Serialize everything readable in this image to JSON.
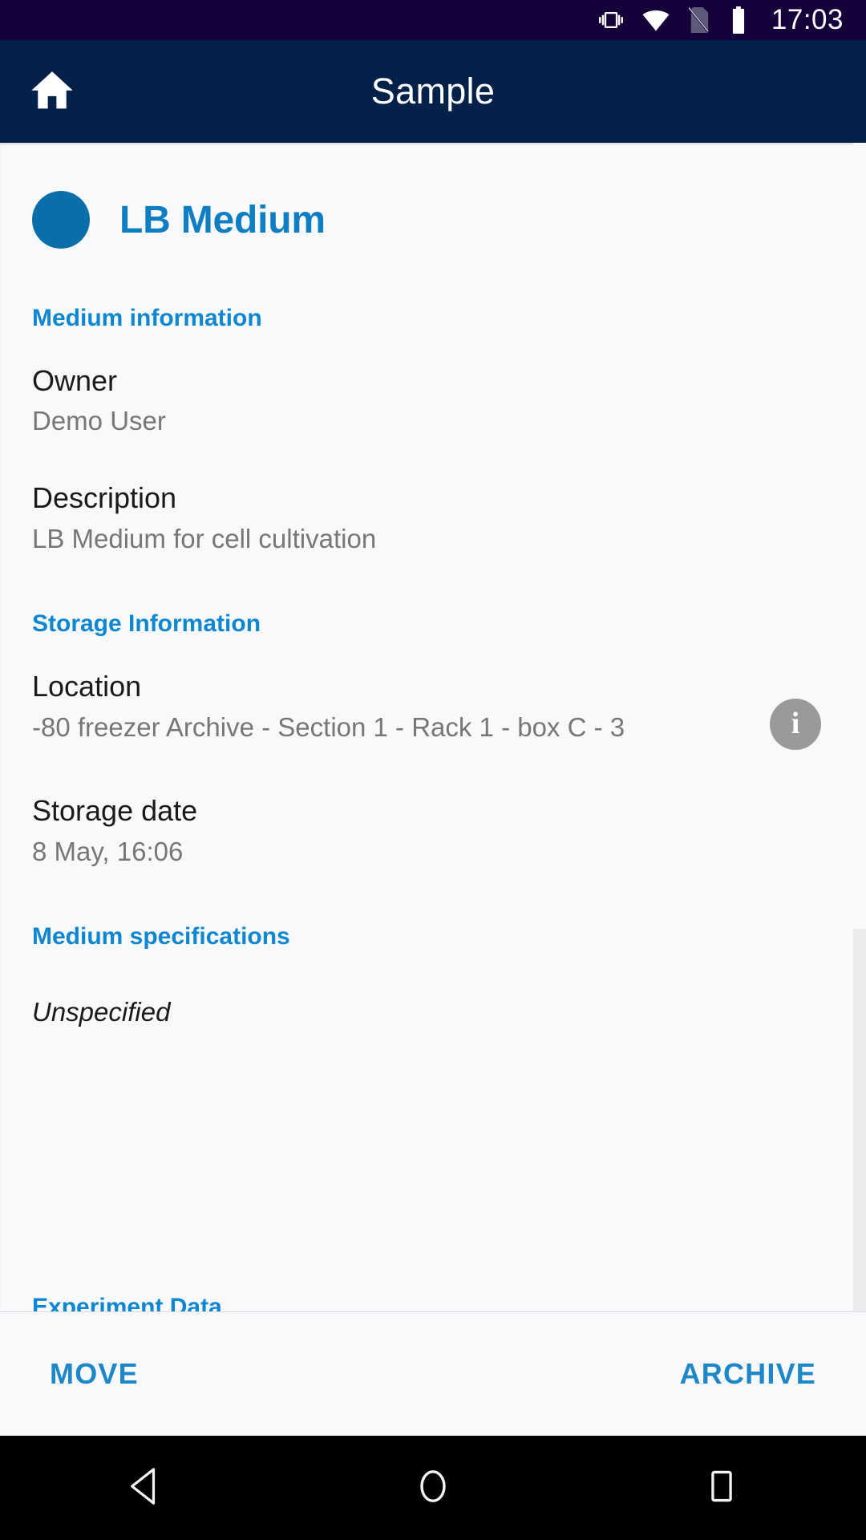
{
  "status_bar": {
    "time": "17:03",
    "icons": [
      "vibrate-icon",
      "wifi-icon",
      "sim-card-off-icon",
      "battery-icon"
    ],
    "background": "#15003a"
  },
  "app_bar": {
    "title": "Sample",
    "home_icon": "home-icon",
    "background": "#04214a"
  },
  "record": {
    "avatar_color": "#0a6fa8",
    "name": "LB Medium"
  },
  "sections": {
    "medium_information": {
      "heading": "Medium information",
      "fields": [
        {
          "label": "Owner",
          "value": "Demo User"
        },
        {
          "label": "Description",
          "value": "LB Medium for cell cultivation"
        }
      ]
    },
    "storage_information": {
      "heading": "Storage Information",
      "fields": [
        {
          "label": "Location",
          "value": "-80 freezer Archive - Section 1 - Rack 1 - box C - 3"
        },
        {
          "label": "Storage date",
          "value": "8 May, 16:06"
        }
      ],
      "info_button": "i"
    },
    "medium_specifications": {
      "heading": "Medium specifications",
      "value": "Unspecified"
    },
    "experiment_data": {
      "heading": "Experiment Data"
    }
  },
  "action_bar": {
    "move_label": "MOVE",
    "archive_label": "ARCHIVE",
    "accent": "#1d87c8"
  },
  "nav_bar": {
    "back": "back-triangle-icon",
    "home": "home-circle-icon",
    "recents": "recents-square-icon"
  }
}
